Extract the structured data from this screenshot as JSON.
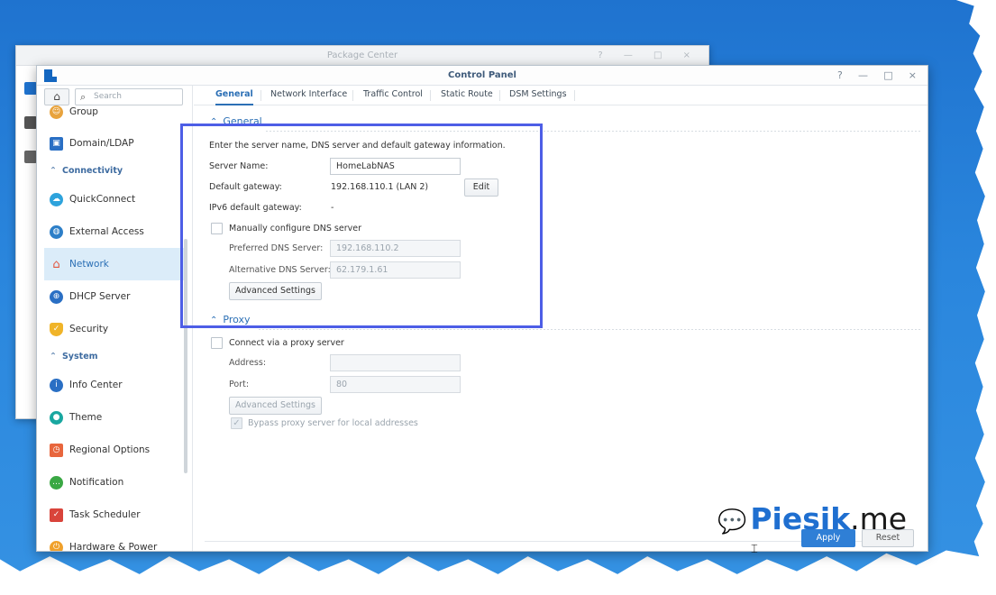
{
  "package_center": {
    "title": "Package Center",
    "controls": [
      "?",
      "—",
      "□",
      "×"
    ]
  },
  "control_panel": {
    "title": "Control Panel",
    "controls": [
      "?",
      "—",
      "□",
      "×"
    ]
  },
  "sidebar": {
    "search_placeholder": "Search",
    "items_top": [
      {
        "label": "Group",
        "icon": "group-icon",
        "color": "#e8a33d"
      },
      {
        "label": "Domain/LDAP",
        "icon": "domain-icon",
        "color": "#2a6fc4"
      }
    ],
    "section_connectivity": "Connectivity",
    "items_connectivity": [
      {
        "label": "QuickConnect",
        "icon": "cloud-icon",
        "color": "#2ea3dc"
      },
      {
        "label": "External Access",
        "icon": "globe-icon",
        "color": "#2d7fc8"
      },
      {
        "label": "Network",
        "icon": "home-network-icon",
        "color": "#e2553e"
      },
      {
        "label": "DHCP Server",
        "icon": "dhcp-icon",
        "color": "#2a6fc4"
      },
      {
        "label": "Security",
        "icon": "shield-icon",
        "color": "#f0b429"
      }
    ],
    "section_system": "System",
    "items_system": [
      {
        "label": "Info Center",
        "icon": "info-icon",
        "color": "#2a6fc4"
      },
      {
        "label": "Theme",
        "icon": "palette-icon",
        "color": "#19a7a0"
      },
      {
        "label": "Regional Options",
        "icon": "clock-icon",
        "color": "#e8663d"
      },
      {
        "label": "Notification",
        "icon": "chat-icon",
        "color": "#3aa844"
      },
      {
        "label": "Task Scheduler",
        "icon": "calendar-icon",
        "color": "#d9443b"
      },
      {
        "label": "Hardware & Power",
        "icon": "power-icon",
        "color": "#f0a12c"
      }
    ]
  },
  "tabs": [
    "General",
    "Network Interface",
    "Traffic Control",
    "Static Route",
    "DSM Settings"
  ],
  "general": {
    "section_title": "General",
    "description": "Enter the server name, DNS server and default gateway information.",
    "server_name_label": "Server Name:",
    "server_name_value": "HomeLabNAS",
    "gateway_label": "Default gateway:",
    "gateway_value": "192.168.110.1 (LAN 2)",
    "edit_button": "Edit",
    "ipv6_label": "IPv6 default gateway:",
    "ipv6_value": "-",
    "manual_dns_label": "Manually configure DNS server",
    "preferred_dns_label": "Preferred DNS Server:",
    "preferred_dns_value": "192.168.110.2",
    "alt_dns_label": "Alternative DNS Server:",
    "alt_dns_value": "62.179.1.61",
    "advanced_button": "Advanced Settings"
  },
  "proxy": {
    "section_title": "Proxy",
    "connect_label": "Connect via a proxy server",
    "address_label": "Address:",
    "address_value": "",
    "port_label": "Port:",
    "port_value": "80",
    "advanced_button": "Advanced Settings",
    "bypass_label": "Bypass proxy server for local addresses"
  },
  "footer": {
    "apply": "Apply",
    "reset": "Reset"
  },
  "watermark": {
    "brand": "Piesik",
    "suffix": ".me"
  },
  "colors": {
    "accent": "#2b6fb5",
    "highlight_border": "#4d5ee6",
    "desktop": "#2a86dd"
  }
}
